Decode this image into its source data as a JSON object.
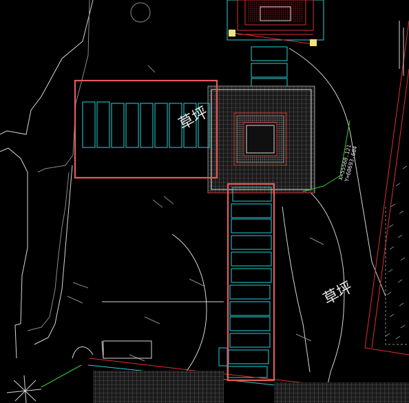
{
  "drawing": {
    "labels": {
      "lawn_upper": "草坪",
      "lawn_lower": "草坪"
    },
    "coordinates": {
      "x": "X=55560.121",
      "y": "Y=60693.604"
    }
  },
  "colors": {
    "background": "#000000",
    "linework": "#d8d8d8",
    "paving": "#29d3d8",
    "boundary": "#e03030",
    "highlight": "#e85a5a",
    "leader": "#35d035"
  }
}
